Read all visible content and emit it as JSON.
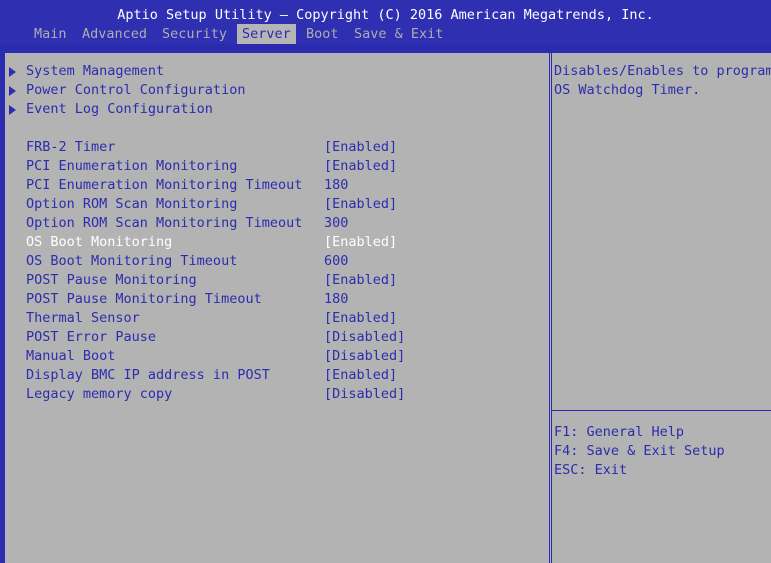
{
  "title": "Aptio Setup Utility – Copyright (C) 2016 American Megatrends, Inc.",
  "tabs": [
    {
      "label": "Main",
      "active": false
    },
    {
      "label": "Advanced",
      "active": false
    },
    {
      "label": "Security",
      "active": false
    },
    {
      "label": "Server",
      "active": true
    },
    {
      "label": "Boot",
      "active": false
    },
    {
      "label": "Save & Exit",
      "active": false
    }
  ],
  "submenus": [
    {
      "label": "System Management"
    },
    {
      "label": "Power Control Configuration"
    },
    {
      "label": "Event Log Configuration"
    }
  ],
  "settings": [
    {
      "label": "FRB-2 Timer",
      "value": "[Enabled]"
    },
    {
      "label": "PCI Enumeration Monitoring",
      "value": "[Enabled]"
    },
    {
      "label": "PCI Enumeration Monitoring Timeout",
      "value": "180"
    },
    {
      "label": "Option ROM Scan Monitoring",
      "value": "[Enabled]"
    },
    {
      "label": "Option ROM Scan Monitoring Timeout",
      "value": "300"
    },
    {
      "label": "OS Boot Monitoring",
      "value": "[Enabled]",
      "selected": true
    },
    {
      "label": "OS Boot Monitoring Timeout",
      "value": "600"
    },
    {
      "label": "POST Pause Monitoring",
      "value": "[Enabled]"
    },
    {
      "label": "POST Pause Monitoring Timeout",
      "value": "180"
    },
    {
      "label": "Thermal Sensor",
      "value": "[Enabled]"
    },
    {
      "label": "POST Error Pause",
      "value": "[Disabled]"
    },
    {
      "label": "Manual Boot",
      "value": "[Disabled]"
    },
    {
      "label": "Display BMC IP address in POST",
      "value": "[Enabled]"
    },
    {
      "label": "Legacy memory copy",
      "value": "[Disabled]"
    }
  ],
  "help": {
    "line1": "Disables/Enables to program",
    "line2": "OS Watchdog Timer."
  },
  "keys": [
    {
      "label": "F1: General Help"
    },
    {
      "label": "F4: Save & Exit Setup"
    },
    {
      "label": "ESC: Exit"
    }
  ],
  "colors": {
    "background": "#2b2bb0",
    "panel": "#b3b3b3",
    "text": "#2c2cae",
    "selected_text": "#ffffff",
    "inactive_tab": "#aeaeae"
  }
}
